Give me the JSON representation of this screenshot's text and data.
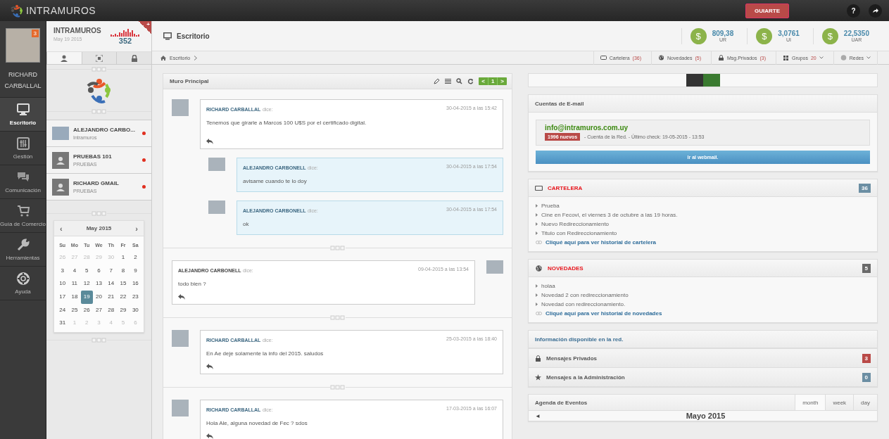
{
  "top_bar": {
    "logo_text": "INTRAMUROS",
    "guide_button": "GUIARTE",
    "help_button": "?"
  },
  "nav": {
    "user": {
      "name": "RICHARD CARBALLAL",
      "badge": "3"
    },
    "items": [
      {
        "label": "Escritorio",
        "selected": true
      },
      {
        "label": "Gestión",
        "selected": false
      },
      {
        "label": "Comunicación",
        "selected": false
      },
      {
        "label": "Guía de Comercio",
        "selected": false
      },
      {
        "label": "Herramientas",
        "selected": false
      },
      {
        "label": "Ayuda",
        "selected": false
      }
    ]
  },
  "network": {
    "title": "INTRAMUROS",
    "date": "May 19 2015",
    "count": "352",
    "corner": "+",
    "tabs": [
      {
        "selected": true
      },
      {
        "selected": false
      },
      {
        "selected": false
      }
    ],
    "contacts": [
      {
        "name": "ALEJANDRO CARBO...",
        "group": "Intramuros",
        "kind": "photo"
      },
      {
        "name": "PRUEBAS 101",
        "group": "PRUEBAS",
        "kind": "generic"
      },
      {
        "name": "RICHARD GMAIL",
        "group": "PRUEBAS",
        "kind": "generic"
      }
    ]
  },
  "calendar": {
    "prev": "‹",
    "title": "May 2015",
    "next": "›",
    "weekdays": [
      "Su",
      "Mo",
      "Tu",
      "We",
      "Th",
      "Fr",
      "Sa"
    ],
    "days": [
      {
        "day": "26",
        "other_month": true,
        "selected": false
      },
      {
        "day": "27",
        "other_month": true,
        "selected": false
      },
      {
        "day": "28",
        "other_month": true,
        "selected": false
      },
      {
        "day": "29",
        "other_month": true,
        "selected": false
      },
      {
        "day": "30",
        "other_month": true,
        "selected": false
      },
      {
        "day": "1",
        "other_month": false,
        "selected": false
      },
      {
        "day": "2",
        "other_month": false,
        "selected": false
      },
      {
        "day": "3",
        "other_month": false,
        "selected": false
      },
      {
        "day": "4",
        "other_month": false,
        "selected": false
      },
      {
        "day": "5",
        "other_month": false,
        "selected": false
      },
      {
        "day": "6",
        "other_month": false,
        "selected": false
      },
      {
        "day": "7",
        "other_month": false,
        "selected": false
      },
      {
        "day": "8",
        "other_month": false,
        "selected": false
      },
      {
        "day": "9",
        "other_month": false,
        "selected": false
      },
      {
        "day": "10",
        "other_month": false,
        "selected": false
      },
      {
        "day": "11",
        "other_month": false,
        "selected": false
      },
      {
        "day": "12",
        "other_month": false,
        "selected": false
      },
      {
        "day": "13",
        "other_month": false,
        "selected": false
      },
      {
        "day": "14",
        "other_month": false,
        "selected": false
      },
      {
        "day": "15",
        "other_month": false,
        "selected": false
      },
      {
        "day": "16",
        "other_month": false,
        "selected": false
      },
      {
        "day": "17",
        "other_month": false,
        "selected": false
      },
      {
        "day": "18",
        "other_month": false,
        "selected": false
      },
      {
        "day": "19",
        "other_month": false,
        "selected": true
      },
      {
        "day": "20",
        "other_month": false,
        "selected": false
      },
      {
        "day": "21",
        "other_month": false,
        "selected": false
      },
      {
        "day": "22",
        "other_month": false,
        "selected": false
      },
      {
        "day": "23",
        "other_month": false,
        "selected": false
      },
      {
        "day": "24",
        "other_month": false,
        "selected": false
      },
      {
        "day": "25",
        "other_month": false,
        "selected": false
      },
      {
        "day": "26",
        "other_month": false,
        "selected": false
      },
      {
        "day": "27",
        "other_month": false,
        "selected": false
      },
      {
        "day": "28",
        "other_month": false,
        "selected": false
      },
      {
        "day": "29",
        "other_month": false,
        "selected": false
      },
      {
        "day": "30",
        "other_month": false,
        "selected": false
      },
      {
        "day": "31",
        "other_month": false,
        "selected": false
      },
      {
        "day": "1",
        "other_month": true,
        "selected": false
      },
      {
        "day": "2",
        "other_month": true,
        "selected": false
      },
      {
        "day": "3",
        "other_month": true,
        "selected": false
      },
      {
        "day": "4",
        "other_month": true,
        "selected": false
      },
      {
        "day": "5",
        "other_month": true,
        "selected": false
      },
      {
        "day": "6",
        "other_month": true,
        "selected": false
      }
    ]
  },
  "page": {
    "title": "Escritorio",
    "breadcrumb": "Escritorio"
  },
  "stats": [
    {
      "symbol": "$",
      "value": "809,38",
      "unit": "UR"
    },
    {
      "symbol": "$",
      "value": "3,0761",
      "unit": "UI"
    },
    {
      "symbol": "$",
      "value": "22,5350",
      "unit": "UAR"
    }
  ],
  "quick_tabs": [
    {
      "label": "Cartelera",
      "count": "(36)",
      "caret": false
    },
    {
      "label": "Novedades",
      "count": "(5)",
      "caret": false
    },
    {
      "label": "Msg.Privados",
      "count": "(3)",
      "caret": false
    },
    {
      "label": "Grupos",
      "count": "20",
      "caret": true
    },
    {
      "label": "Redes",
      "caret": true
    }
  ],
  "feed": {
    "title": "Muro Principal",
    "pager": {
      "prev": "<",
      "page": "1",
      "next": ">"
    },
    "posts": [
      {
        "kind": "post",
        "author": "RICHARD CARBALLAL",
        "says": "dice:",
        "time": "30-04-2015 a las 15:42",
        "text": "Tenemos que girarle a Marcos 100 U$S por el certificado digital."
      },
      {
        "kind": "reply",
        "author": "ALEJANDRO CARBONELL",
        "says": "dice:",
        "time": "30-04-2015 a las 17:54",
        "text": "avisame cuando te lo doy"
      },
      {
        "kind": "reply",
        "author": "ALEJANDRO CARBONELL",
        "says": "dice:",
        "time": "30-04-2015 a las 17:54",
        "text": "ok"
      },
      {
        "kind": "post_mirrored",
        "author": "ALEJANDRO CARBONELL",
        "says": "dice:",
        "time": "09-04-2015 a las 13:54",
        "text": "todo bien ?"
      },
      {
        "kind": "post",
        "author": "RICHARD CARBALLAL",
        "says": "dice:",
        "time": "25-03-2015 a las 18:40",
        "text": "En Ae deje solamente la info del 2015. saludos"
      },
      {
        "kind": "post",
        "author": "RICHARD CARBALLAL",
        "says": "dice:",
        "time": "17-03-2015 a las 16:07",
        "text": "Hola Ale, alguna novedad de Fec ? sdos"
      }
    ]
  },
  "email": {
    "title": "Cuentas de E-mail",
    "address": "info@intramuros.com.uy",
    "badge": "1996 nuevos",
    "detail": "- Cuenta de la Red. - Último check: 19-05-2015 - 13:53",
    "button": "Ir al webmail."
  },
  "cartelera": {
    "title": "CARTELERA",
    "count": "36",
    "color": "#6b8ea3",
    "items": [
      "Prueba",
      "Cine en Fecovi, el viernes 3 de octubre a las 19 horas.",
      "Nuevo Redireccionamiento",
      "Titulo con Redireccionamiento"
    ],
    "link": "Cliqué aquí para ver historial de cartelera"
  },
  "novedades": {
    "title": "NOVEDADES",
    "count": "5",
    "color": "#6a6a6a",
    "items": [
      "holaa",
      "Novedad 2 con redireccionamiento",
      "Novedad con redireccionamiento."
    ],
    "link": "Cliqué aquí para ver historial de novedades"
  },
  "info": {
    "title": "Información disponible en la red.",
    "rows": [
      {
        "label": "Mensajes Privados",
        "count": "3",
        "color": "#b94a48"
      },
      {
        "label": "Mensajes a la Administración",
        "count": "0",
        "color": "#6b8ea3"
      }
    ]
  },
  "agenda": {
    "title": "Agenda de Eventos",
    "views": [
      {
        "label": "month",
        "selected": true
      },
      {
        "label": "week",
        "selected": false
      },
      {
        "label": "day",
        "selected": false
      }
    ],
    "prev": "◄",
    "month": "Mayo 2015"
  }
}
